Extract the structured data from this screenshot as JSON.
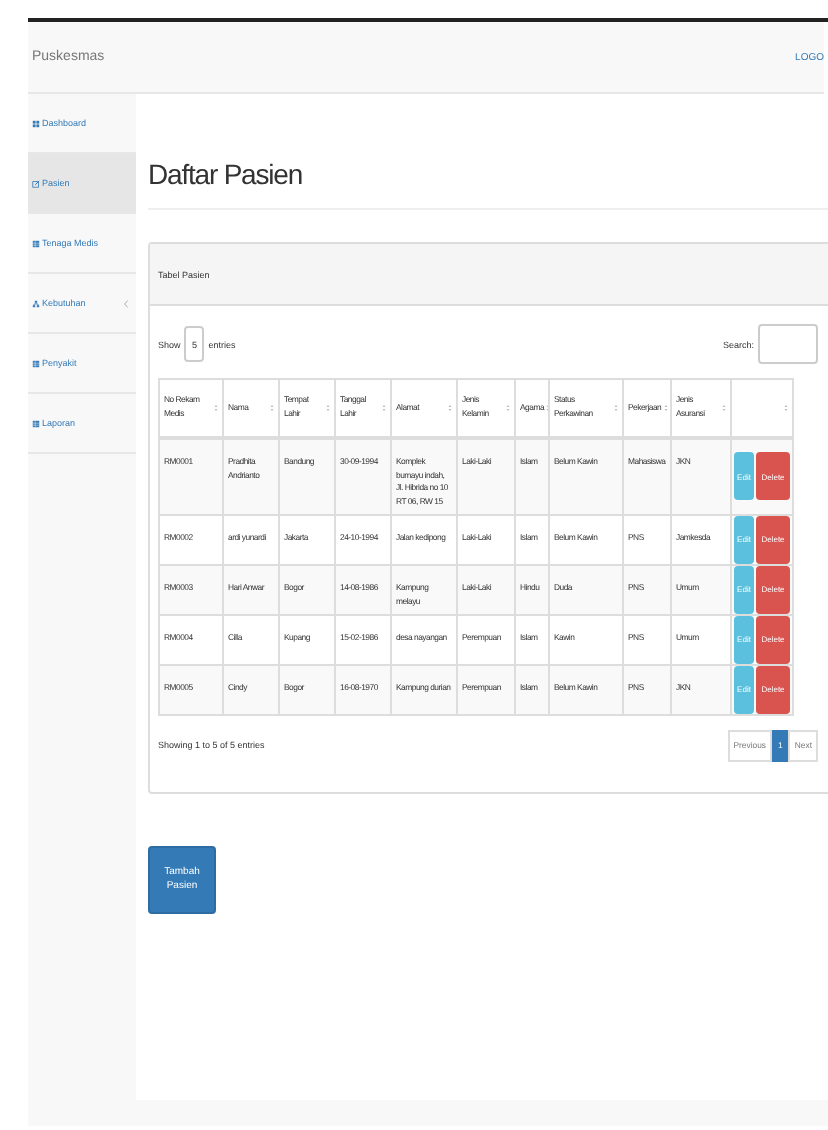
{
  "navbar": {
    "brand": "Puskesmas",
    "logout": "LOGO"
  },
  "sidebar": {
    "items": [
      {
        "label": "Dashboard",
        "selected": false,
        "expandable": false
      },
      {
        "label": "Pasien",
        "selected": true,
        "expandable": false
      },
      {
        "label": "Tenaga Medis",
        "selected": false,
        "expandable": false
      },
      {
        "label": "Kebutuhan",
        "selected": false,
        "expandable": true
      },
      {
        "label": "Penyakit",
        "selected": false,
        "expandable": false
      },
      {
        "label": "Laporan",
        "selected": false,
        "expandable": false
      }
    ]
  },
  "page_title": "Daftar Pasien",
  "panel": {
    "heading": "Tabel Pasien",
    "show_label": "Show",
    "entries_value": "5",
    "entries_label": "entries",
    "search_label": "Search:"
  },
  "table": {
    "columns": [
      "No Rekam Medis",
      "Nama",
      "Tempat Lahir",
      "Tanggal Lahir",
      "Alamat",
      "Jenis Kelamin",
      "Agama",
      "Status Perkawinan",
      "Pekerjaan",
      "Jenis Asuransi"
    ],
    "rows": [
      {
        "cells": [
          "RM0001",
          "Pradhita Andrianto",
          "Bandung",
          "30-09-1994",
          "Komplek bumayu indah, Jl. Hibrida no 10 RT 06, RW 15",
          "Laki-Laki",
          "Islam",
          "Belum Kawin",
          "Mahasiswa",
          "JKN"
        ],
        "edit": "Edit",
        "delete": "Delete"
      },
      {
        "cells": [
          "RM0002",
          "ardi yunardi",
          "Jakarta",
          "24-10-1994",
          "Jalan kedipong",
          "Laki-Laki",
          "Islam",
          "Belum Kawin",
          "PNS",
          "Jamkesda"
        ],
        "edit": "Edit",
        "delete": "Delete"
      },
      {
        "cells": [
          "RM0003",
          "Hari Anwar",
          "Bogor",
          "14-08-1986",
          "Kampung melayu",
          "Laki-Laki",
          "Hindu",
          "Duda",
          "PNS",
          "Umum"
        ],
        "edit": "Edit",
        "delete": "Delete"
      },
      {
        "cells": [
          "RM0004",
          "Cilla",
          "Kupang",
          "15-02-1986",
          "desa nayangan",
          "Perempuan",
          "Islam",
          "Kawin",
          "PNS",
          "Umum"
        ],
        "edit": "Edit",
        "delete": "Delete"
      },
      {
        "cells": [
          "RM0005",
          "Cindy",
          "Bogor",
          "16-08-1970",
          "Kampung durian",
          "Perempuan",
          "Islam",
          "Belum Kawin",
          "PNS",
          "JKN"
        ],
        "edit": "Edit",
        "delete": "Delete"
      }
    ]
  },
  "info": "Showing 1 to 5 of 5 entries",
  "pagination": [
    {
      "label": "Previous",
      "selected": false
    },
    {
      "label": "1",
      "selected": true
    },
    {
      "label": "Next",
      "selected": false
    }
  ],
  "add_button": "Tambah Pasien"
}
